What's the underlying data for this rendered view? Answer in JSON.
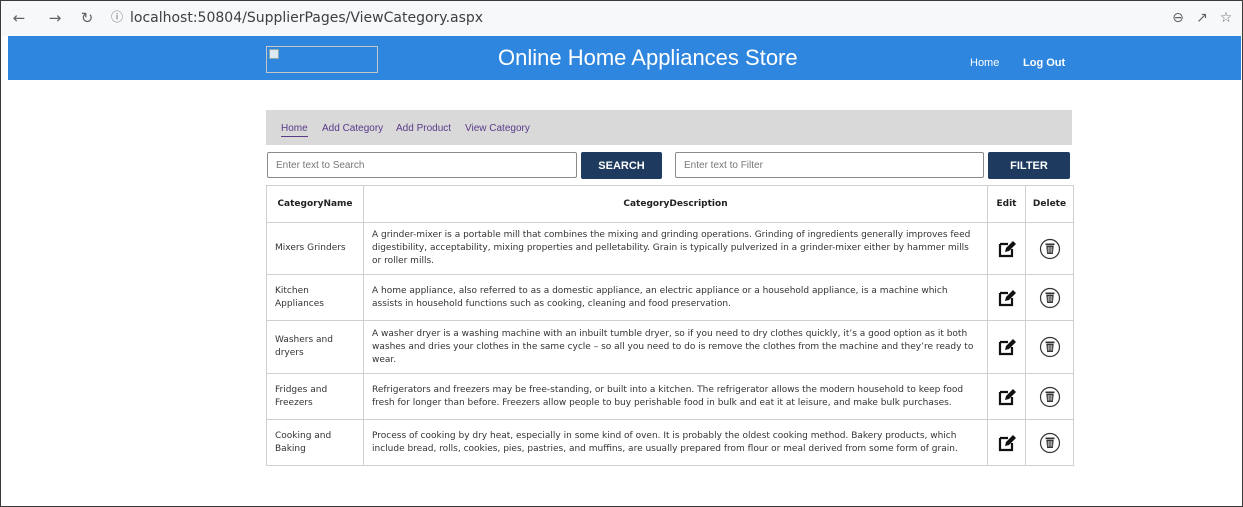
{
  "browser": {
    "back_icon": "arrow-left-icon",
    "forward_icon": "arrow-right-icon",
    "reload_icon": "reload-icon",
    "url": "localhost:50804/SupplierPages/ViewCategory.aspx",
    "right_icons": [
      "zoom-out-icon",
      "share-icon",
      "star-icon"
    ]
  },
  "header": {
    "title": "Online Home Appliances Store",
    "links": {
      "home": "Home",
      "logout": "Log Out"
    },
    "color": "#2f86de"
  },
  "subnav": {
    "items": [
      {
        "label": "Home"
      },
      {
        "label": "Add Category"
      },
      {
        "label": "Add Product"
      },
      {
        "label": "View Category"
      }
    ]
  },
  "search": {
    "placeholder": "Enter text to Search",
    "button": "SEARCH",
    "filter_placeholder": "Enter text to Filter",
    "filter_button": "FILTER"
  },
  "table": {
    "headers": [
      "CategoryName",
      "CategoryDescription",
      "Edit",
      "Delete"
    ],
    "rows": [
      {
        "name": "Mixers Grinders",
        "description": "A grinder-mixer is a portable mill that combines the mixing and grinding operations. Grinding of ingredients generally improves feed digestibility, acceptability, mixing properties and pelletability. Grain is typically pulverized in a grinder-mixer either by hammer mills or roller mills."
      },
      {
        "name": "Kitchen Appliances",
        "description": "A home appliance, also referred to as a domestic appliance, an electric appliance or a household appliance, is a machine which assists in household functions such as cooking, cleaning and food preservation."
      },
      {
        "name": "Washers and dryers",
        "description": "A washer dryer is a washing machine with an inbuilt tumble dryer, so if you need to dry clothes quickly, it’s a good option as it both washes and dries your clothes in the same cycle – so all you need to do is remove the clothes from the machine and they’re ready to wear."
      },
      {
        "name": "Fridges and Freezers",
        "description": "Refrigerators and freezers may be free-standing, or built into a kitchen. The refrigerator allows the modern household to keep food fresh for longer than before. Freezers allow people to buy perishable food in bulk and eat it at leisure, and make bulk purchases."
      },
      {
        "name": "Cooking and Baking",
        "description": "Process of cooking by dry heat, especially in some kind of oven. It is probably the oldest cooking method. Bakery products, which include bread, rolls, cookies, pies, pastries, and muffins, are usually prepared from flour or meal derived from some form of grain."
      }
    ],
    "edit_icon": "edit-icon",
    "delete_icon": "trash-icon"
  }
}
